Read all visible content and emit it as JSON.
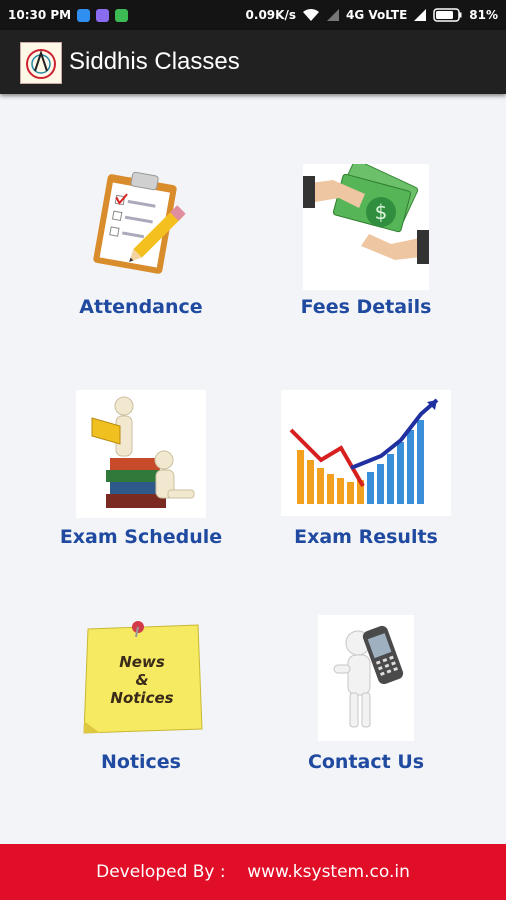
{
  "status_bar": {
    "time": "10:30 PM",
    "net_speed": "0.09K/s",
    "network": "4G VoLTE",
    "battery": "81%"
  },
  "app_bar": {
    "title": "Siddhis Classes"
  },
  "menu": [
    {
      "label": "Attendance",
      "icon": "clipboard-pencil-icon"
    },
    {
      "label": "Fees Details",
      "icon": "money-exchange-icon"
    },
    {
      "label": "Exam Schedule",
      "icon": "reading-books-icon"
    },
    {
      "label": "Exam Results",
      "icon": "growth-bar-chart-icon"
    },
    {
      "label": "Notices",
      "icon": "news-notices-note-icon"
    },
    {
      "label": "Contact Us",
      "icon": "person-phone-icon"
    }
  ],
  "footer": {
    "prefix": "Developed By :",
    "link": "www.ksystem.co.in"
  },
  "colors": {
    "accent_text": "#1f4aa0",
    "footer_bg": "#e10e28",
    "appbar_bg": "#212121"
  }
}
